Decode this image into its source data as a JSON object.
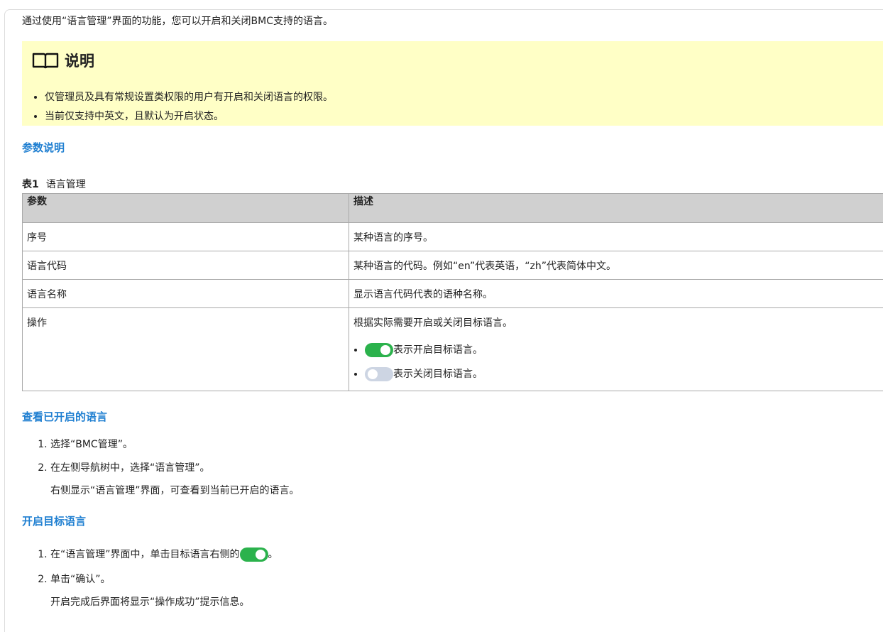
{
  "intro": "通过使用“语言管理”界面的功能，您可以开启和关闭BMC支持的语言。",
  "note": {
    "title": "说明",
    "icon": "book-icon",
    "items": [
      "仅管理员及具有常规设置类权限的用户有开启和关闭语言的权限。",
      "当前仅支持中英文，且默认为开启状态。"
    ]
  },
  "sections": {
    "params_heading": "参数说明",
    "view_heading": "查看已开启的语言",
    "enable_heading": "开启目标语言"
  },
  "table": {
    "caption_label": "表1",
    "caption_title": "语言管理",
    "headers": [
      "参数",
      "描述"
    ],
    "rows": [
      {
        "param": "序号",
        "desc": "某种语言的序号。"
      },
      {
        "param": "语言代码",
        "desc": "某种语言的代码。例如“en”代表英语，“zh”代表简体中文。"
      },
      {
        "param": "语言名称",
        "desc": "显示语言代码代表的语种名称。"
      },
      {
        "param": "操作",
        "desc": "根据实际需要开启或关闭目标语言。"
      }
    ],
    "op_items": [
      {
        "state": "on",
        "text": "表示开启目标语言。"
      },
      {
        "state": "off",
        "text": "表示关闭目标语言。"
      }
    ]
  },
  "view_steps": [
    {
      "text": "选择“BMC管理”。"
    },
    {
      "text": "在左侧导航树中，选择“语言管理”。",
      "result": "右侧显示“语言管理”界面，可查看到当前已开启的语言。"
    }
  ],
  "enable_steps": [
    {
      "text_before": "在“语言管理”界面中，单击目标语言右侧的",
      "text_after": "。"
    },
    {
      "text": "单击“确认”。",
      "result": "开启完成后界面将显示“操作成功”提示信息。"
    }
  ],
  "colors": {
    "accent": "#1f7fd1",
    "note_bg": "#ffffc6",
    "toggle_on": "#2bb24c",
    "toggle_off": "#cdd5e3"
  }
}
